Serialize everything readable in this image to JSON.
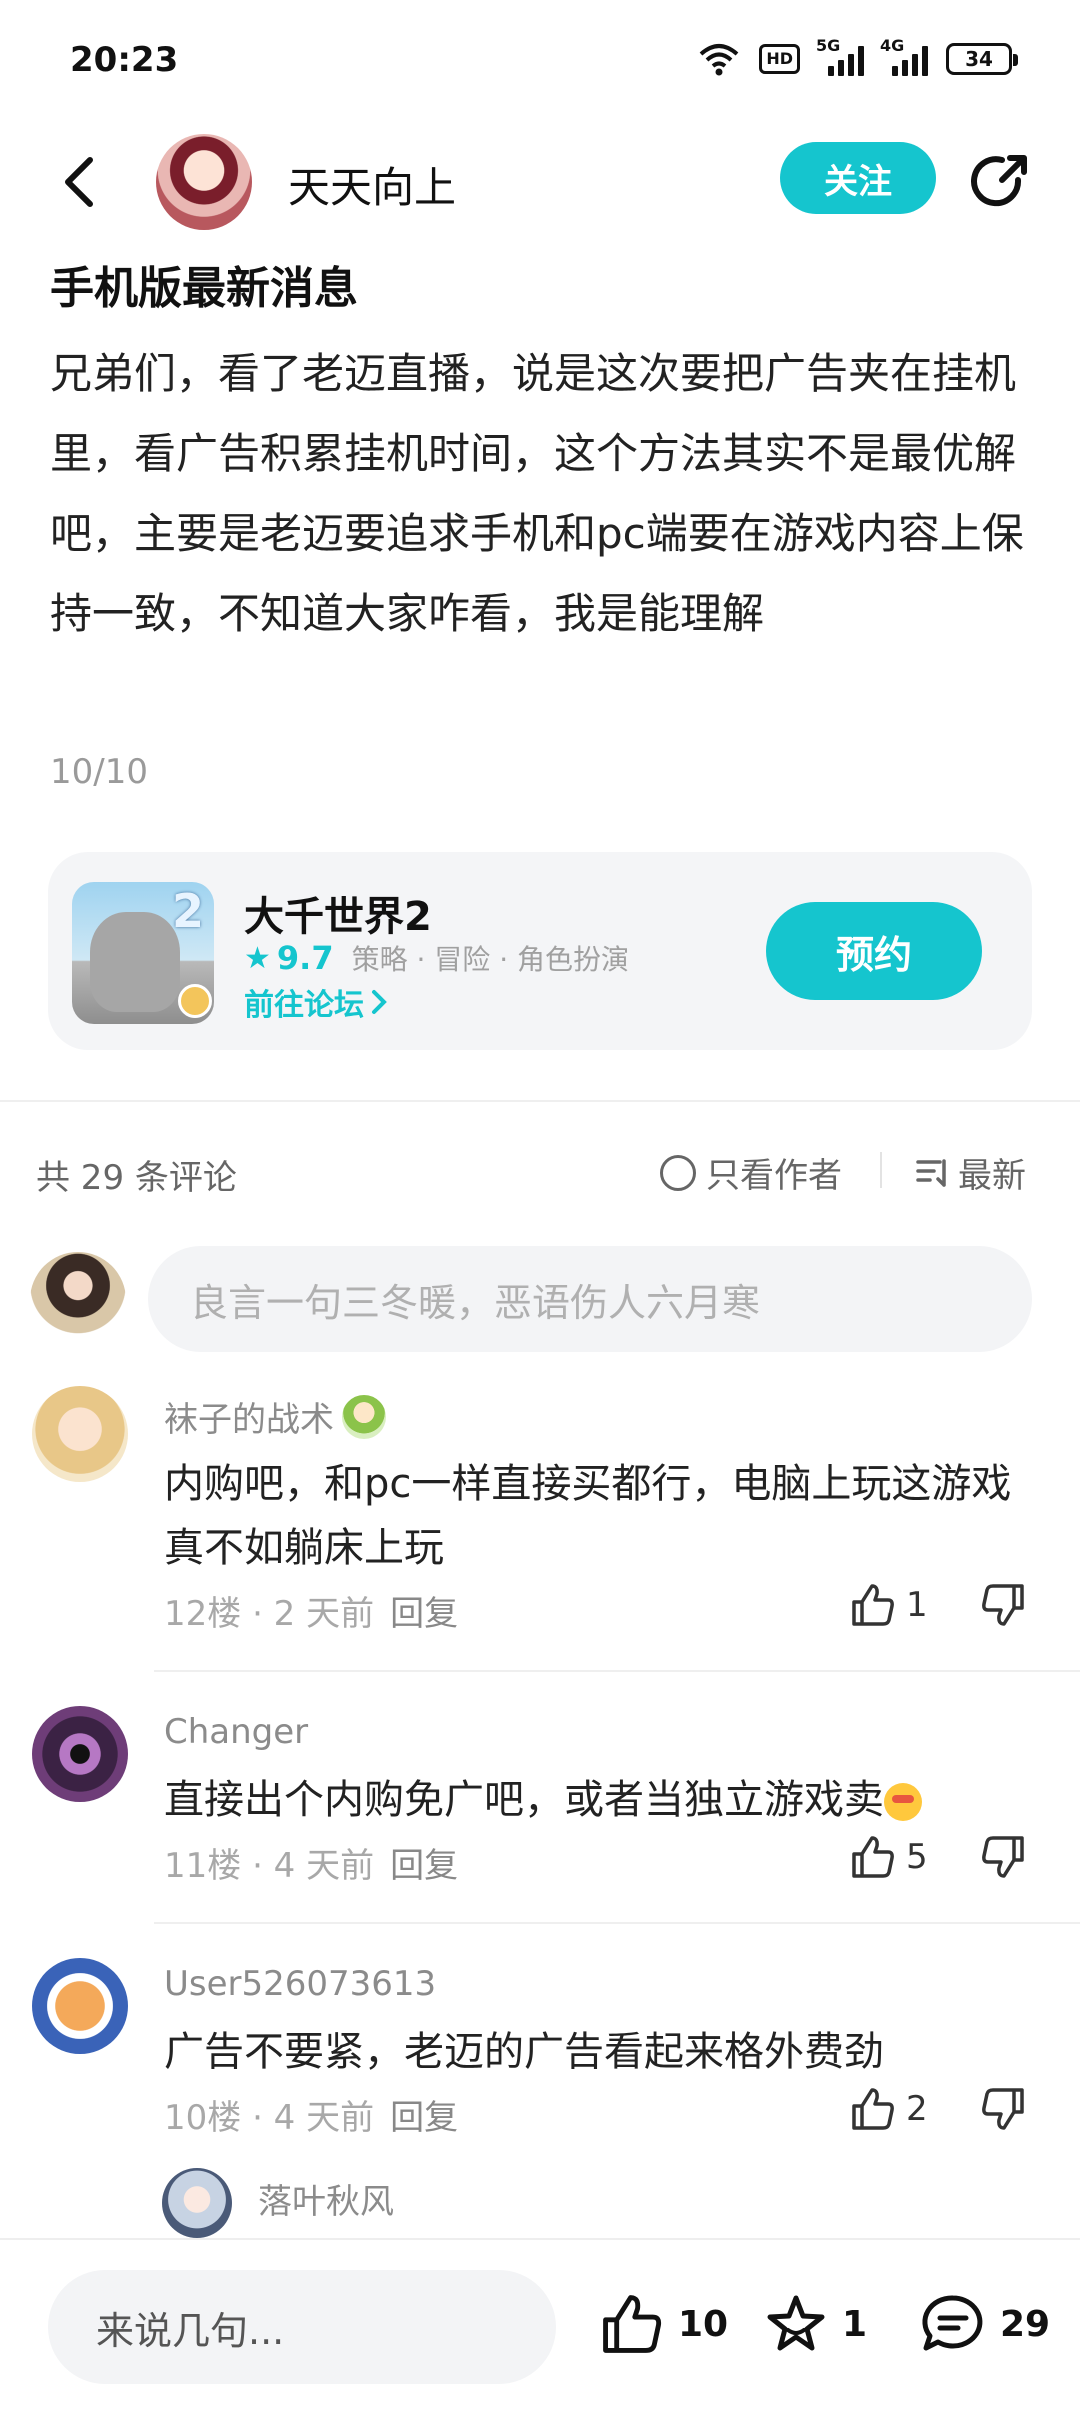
{
  "status_bar": {
    "time": "20:23",
    "hd": "HD",
    "net1": "5G",
    "net2": "4G",
    "battery": "34"
  },
  "header": {
    "author_name": "天天向上",
    "follow_label": "关注"
  },
  "post": {
    "title": "手机版最新消息",
    "body": "兄弟们，看了老迈直播，说是这次要把广告夹在挂机里，看广告积累挂机时间，这个方法其实不是最优解吧，主要是老迈要追求手机和pc端要在游戏内容上保持一致，不知道大家咋看，我是能理解",
    "page": "10/10"
  },
  "game_card": {
    "name": "大千世界2",
    "icon_number": "2",
    "score": "9.7",
    "tags": "策略 · 冒险 · 角色扮演",
    "forum_link": "前往论坛",
    "reserve_label": "预约"
  },
  "comments_header": {
    "count": "共 29 条评论",
    "author_only": "只看作者",
    "sort": "最新"
  },
  "comment_input": {
    "placeholder": "良言一句三冬暖，恶语伤人六月寒"
  },
  "comments": [
    {
      "name": "袜子的战术",
      "text": "内购吧，和pc一样直接买都行，电脑上玩这游戏真不如躺床上玩",
      "meta": "12楼 · 2 天前",
      "reply": "回复",
      "likes": "1"
    },
    {
      "name": "Changer",
      "text": "直接出个内购免广吧，或者当独立游戏卖",
      "meta": "11楼 · 4 天前",
      "reply": "回复",
      "likes": "5"
    },
    {
      "name": "User526073613",
      "text": "广告不要紧，老迈的广告看起来格外费劲",
      "meta": "10楼 · 4 天前",
      "reply": "回复",
      "likes": "2"
    }
  ],
  "reply_preview": {
    "name": "落叶秋风"
  },
  "bottom_bar": {
    "input_placeholder": "来说几句...",
    "likes": "10",
    "favorites": "1",
    "comments": "29"
  },
  "colors": {
    "accent": "#15c5ce"
  }
}
